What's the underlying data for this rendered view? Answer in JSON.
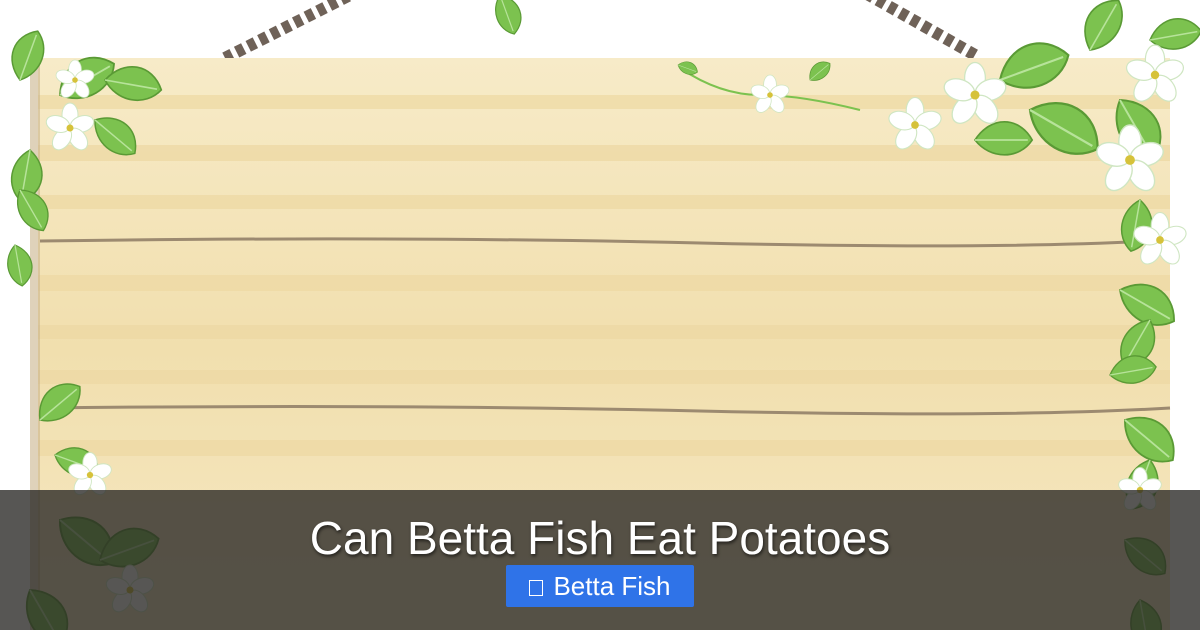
{
  "post": {
    "title": "Can Betta Fish Eat Potatoes",
    "category_label": "Betta Fish",
    "category_icon": "folder-icon"
  },
  "colors": {
    "board": "#f5e6bf",
    "board_stripe": "#efdcaa",
    "leaf": "#7cc24f",
    "banner": "#282624",
    "tag_bg": "#2f73e8"
  }
}
